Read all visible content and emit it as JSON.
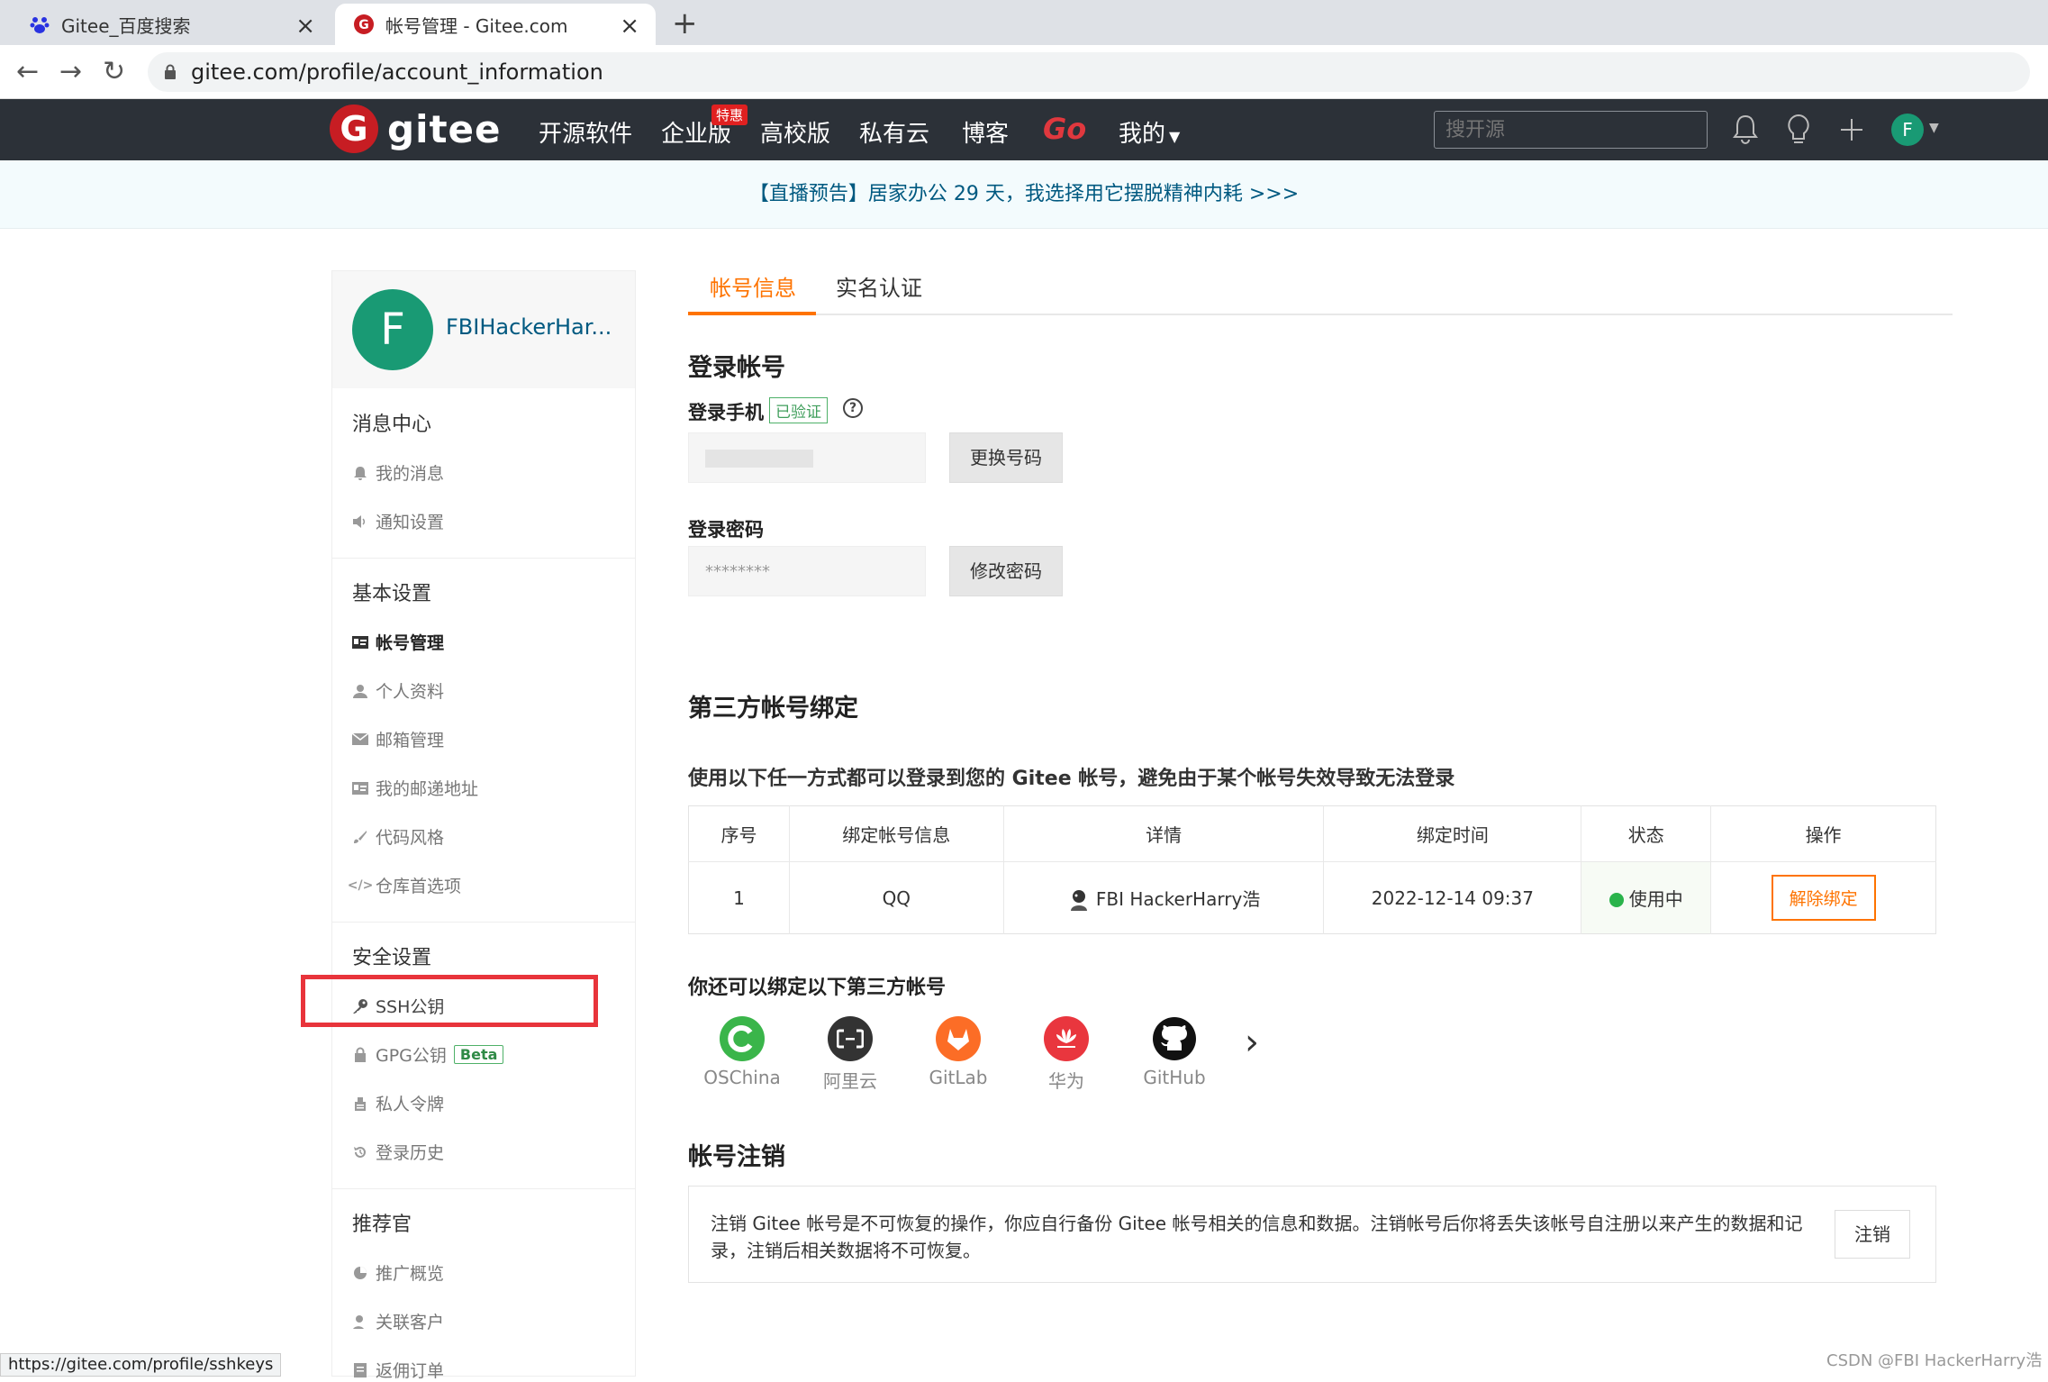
{
  "browser": {
    "tabs": [
      {
        "title": "Gitee_百度搜索"
      },
      {
        "title": "帐号管理 - Gitee.com"
      }
    ],
    "url": "gitee.com/profile/account_information",
    "status_url": "https://gitee.com/profile/sshkeys"
  },
  "header": {
    "logo_text": "gitee",
    "logo_letter": "G",
    "nav": [
      "开源软件",
      "企业版",
      "高校版",
      "私有云",
      "博客",
      "我的"
    ],
    "badge": "特惠",
    "go": "Go",
    "search_placeholder": "搜开源",
    "avatar_letter": "F"
  },
  "notice": "【直播预告】居家办公 29 天，我选择用它摆脱精神内耗 >>>",
  "sidebar": {
    "avatar_letter": "F",
    "username": "FBIHackerHar...",
    "sections": [
      {
        "title": "消息中心",
        "items": [
          "我的消息",
          "通知设置"
        ]
      },
      {
        "title": "基本设置",
        "items": [
          "帐号管理",
          "个人资料",
          "邮箱管理",
          "我的邮递地址",
          "代码风格",
          "仓库首选项"
        ]
      },
      {
        "title": "安全设置",
        "items": [
          "SSH公钥",
          "GPG公钥",
          "私人令牌",
          "登录历史"
        ]
      },
      {
        "title": "推荐官",
        "items": [
          "推广概览",
          "关联客户",
          "返佣订单"
        ]
      }
    ],
    "beta": "Beta"
  },
  "main": {
    "tabs": [
      "帐号信息",
      "实名认证"
    ],
    "login_title": "登录帐号",
    "phone_label": "登录手机",
    "verified": "已验证",
    "help": "?",
    "change_phone": "更换号码",
    "password_label": "登录密码",
    "password_mask": "********",
    "change_password": "修改密码",
    "third_title": "第三方帐号绑定",
    "third_subtitle": "使用以下任一方式都可以登录到您的 Gitee 帐号，避免由于某个帐号失效导致无法登录",
    "table": {
      "headers": [
        "序号",
        "绑定帐号信息",
        "详情",
        "绑定时间",
        "状态",
        "操作"
      ],
      "row": {
        "no": "1",
        "account": "QQ",
        "detail": "FBI HackerHarry浩",
        "time": "2022-12-14 09:37",
        "status": "使用中",
        "action": "解除绑定"
      }
    },
    "more_title": "你还可以绑定以下第三方帐号",
    "providers": [
      "OSChina",
      "阿里云",
      "GitLab",
      "华为",
      "GitHub"
    ],
    "cancel_title": "帐号注销",
    "cancel_text": "注销 Gitee 帐号是不可恢复的操作，你应自行备份 Gitee 帐号相关的信息和数据。注销帐号后你将丢失该帐号自注册以来产生的数据和记录，注销后相关数据将不可恢复。",
    "cancel_btn": "注销"
  },
  "watermark": "CSDN @FBI HackerHarry浩",
  "colors": {
    "accent": "#fe7300",
    "header_bg": "#2c3138",
    "brand_red": "#c71d23",
    "highlight": "#e8343b"
  }
}
